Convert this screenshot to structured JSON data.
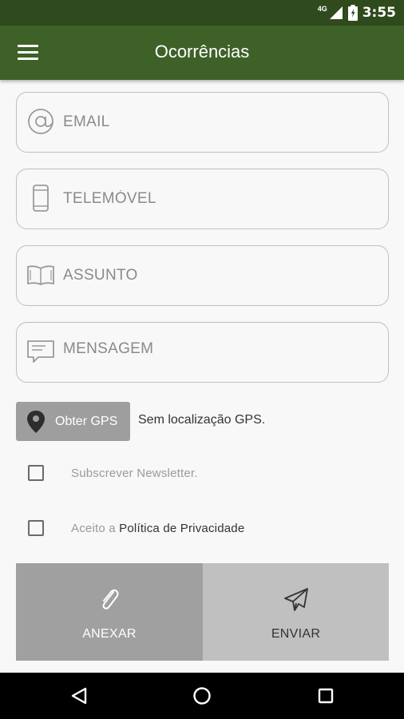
{
  "status_bar": {
    "network": "4G",
    "time": "3:55"
  },
  "app_bar": {
    "title": "Ocorrências"
  },
  "form": {
    "email_placeholder": "EMAIL",
    "phone_placeholder": "TELEMÓVEL",
    "subject_placeholder": "ASSUNTO",
    "message_placeholder": "MENSAGEM"
  },
  "gps": {
    "button_label": "Obter GPS",
    "status": "Sem localização GPS."
  },
  "checkboxes": {
    "newsletter_label": "Subscrever Newsletter.",
    "privacy_prefix": "Aceito a ",
    "privacy_link": "Política de Privacidade"
  },
  "actions": {
    "attach_label": "ANEXAR",
    "send_label": "ENVIAR"
  },
  "icons": {
    "menu": "hamburger-menu-icon",
    "email": "at-sign-icon",
    "phone": "mobile-phone-icon",
    "subject": "open-book-icon",
    "message": "chat-bubble-icon",
    "gps": "location-pin-icon",
    "attach": "paperclip-icon",
    "send": "paper-plane-icon"
  },
  "colors": {
    "status_bar": "#2f4a1c",
    "app_bar": "#3e6128",
    "attach_bg": "#a0a0a0",
    "send_bg": "#c0c0c0"
  }
}
